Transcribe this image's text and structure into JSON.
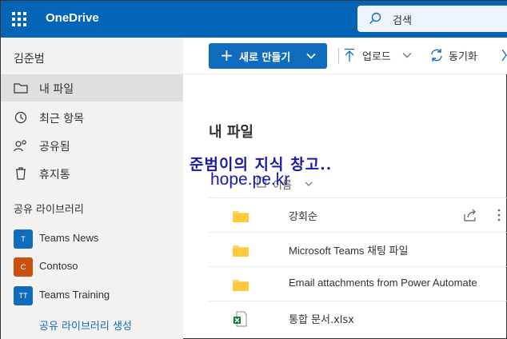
{
  "header": {
    "app_title": "OneDrive",
    "search_placeholder": "검색",
    "brand_color": "#0364b8"
  },
  "sidebar": {
    "user_name": "김준범",
    "nav_items": [
      {
        "label": "내 파일",
        "icon": "folder-icon",
        "selected": true
      },
      {
        "label": "최근 항목",
        "icon": "history-icon",
        "selected": false
      },
      {
        "label": "공유됨",
        "icon": "people-icon",
        "selected": false
      },
      {
        "label": "휴지통",
        "icon": "trash-icon",
        "selected": false
      }
    ],
    "shared_section_title": "공유 라이브러리",
    "libraries": [
      {
        "badge": "T",
        "label": "Teams News",
        "color": "#0f6cbd"
      },
      {
        "badge": "C",
        "label": "Contoso",
        "color": "#ca5010"
      },
      {
        "badge": "TT",
        "label": "Teams Training",
        "color": "#0f6cbd"
      }
    ],
    "create_link": "공유 라이브러리 생성"
  },
  "command_bar": {
    "new_label": "새로 만들기",
    "upload_label": "업로드",
    "sync_label": "동기화"
  },
  "main": {
    "page_title": "내 파일",
    "watermark_line1": "준범이의 지식 창고..",
    "watermark_line2": "hope.pe.kr",
    "column_name": "이름",
    "files": [
      {
        "name": "강회순",
        "type": "folder"
      },
      {
        "name": "Microsoft Teams 채팅 파일",
        "type": "folder"
      },
      {
        "name": "Email attachments from Power Automate",
        "type": "folder"
      },
      {
        "name": "통합 문서.xlsx",
        "type": "excel"
      }
    ]
  }
}
